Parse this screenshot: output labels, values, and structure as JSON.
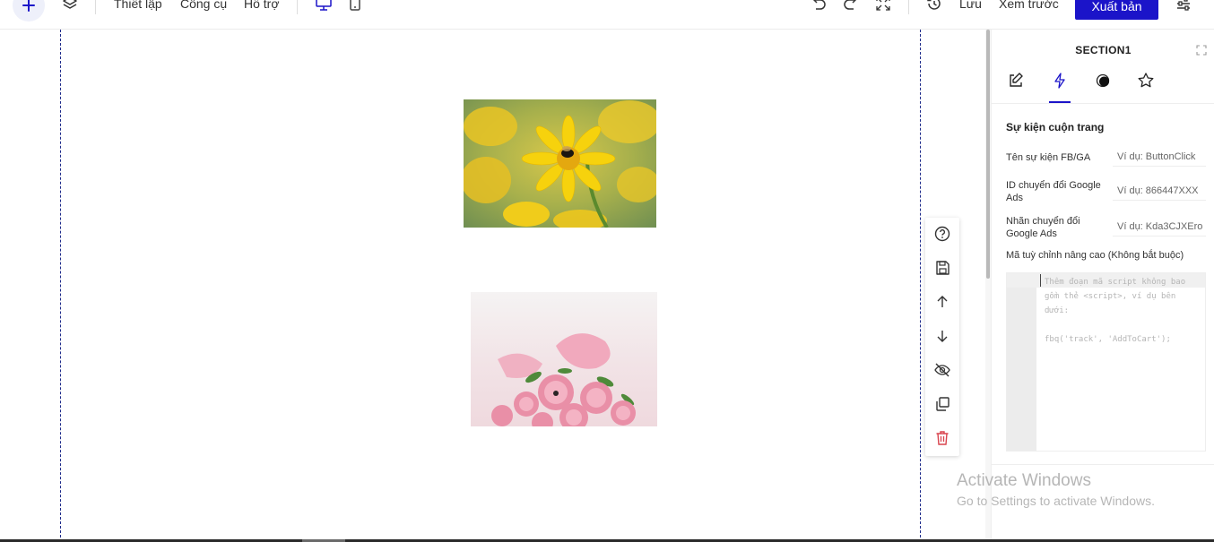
{
  "toolbar": {
    "menu": [
      "Thiết lập",
      "Công cụ",
      "Hỗ trợ"
    ],
    "save_label": "Lưu",
    "preview_label": "Xem trước",
    "publish_label": "Xuất bản"
  },
  "panel": {
    "title": "SECTION1",
    "section_heading": "Sự kiện cuộn trang",
    "fields": [
      {
        "label": "Tên sự kiện FB/GA",
        "placeholder": "Ví dụ: ButtonClick"
      },
      {
        "label": "ID chuyển đổi Google Ads",
        "placeholder": "Ví dụ: 866447XXX"
      },
      {
        "label": "Nhãn chuyển đổi Google Ads",
        "placeholder": "Ví dụ: Kda3CJXEro"
      }
    ],
    "advanced_label": "Mã tuỳ chỉnh nâng cao (Không bắt buộc)",
    "code_placeholder": "Thêm đoạn mã script không bao gồm thẻ <script>, ví dụ bên dưới:\n\nfbq('track', 'AddToCart');"
  },
  "watermark": {
    "line1": "Activate Windows",
    "line2": "Go to Settings to activate Windows."
  },
  "colors": {
    "accent": "#1b14c9",
    "danger": "#d9434d"
  }
}
